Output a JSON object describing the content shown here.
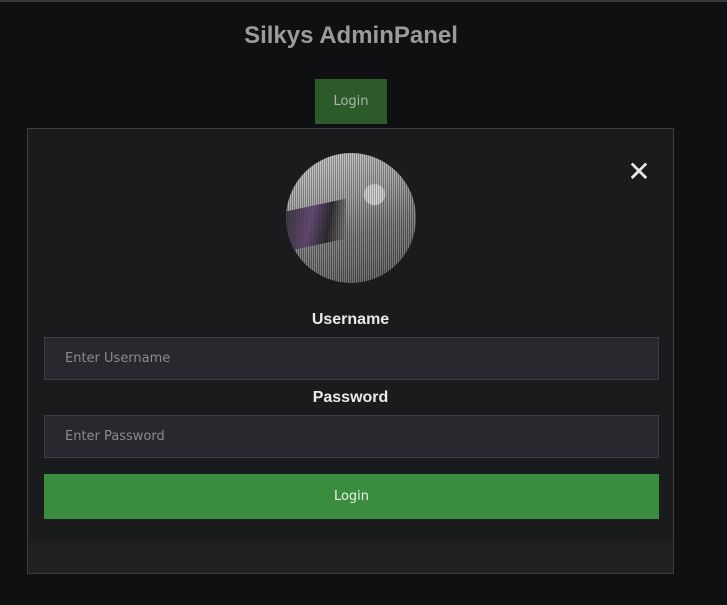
{
  "header": {
    "title": "Silkys AdminPanel",
    "login_button_label": "Login"
  },
  "modal": {
    "close_icon": "close-icon",
    "close_glyph": "✕",
    "avatar_icon": "avatar",
    "username": {
      "label": "Username",
      "placeholder": "Enter Username",
      "value": ""
    },
    "password": {
      "label": "Password",
      "placeholder": "Enter Password",
      "value": ""
    },
    "submit_label": "Login"
  },
  "colors": {
    "background": "#0f1012",
    "modal_background": "#1a1b1d",
    "header_button": "#2d5a2b",
    "submit_button": "#3a8c3f",
    "input_background": "#28282f"
  }
}
